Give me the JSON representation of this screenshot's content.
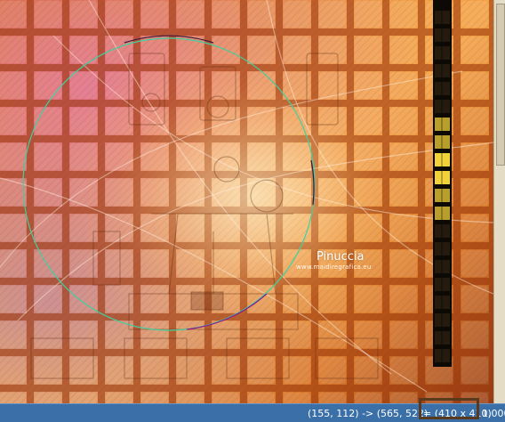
{
  "canvas": {
    "watermark_title": "Pinuccia",
    "watermark_url": "www.maidiregrafica.eu",
    "colors": {
      "base": "#f1a04a",
      "magenta": "#d45ac8",
      "selection_circle": "#40d0a0",
      "strip": "#0d0a06",
      "strip_highlight": "#f2d23a"
    },
    "selection_shape": "ellipse"
  },
  "statusbar": {
    "coords": "(155, 112) -> (565, 522)",
    "sel_size": "= (410 x 410)",
    "zoom": "1,000"
  }
}
